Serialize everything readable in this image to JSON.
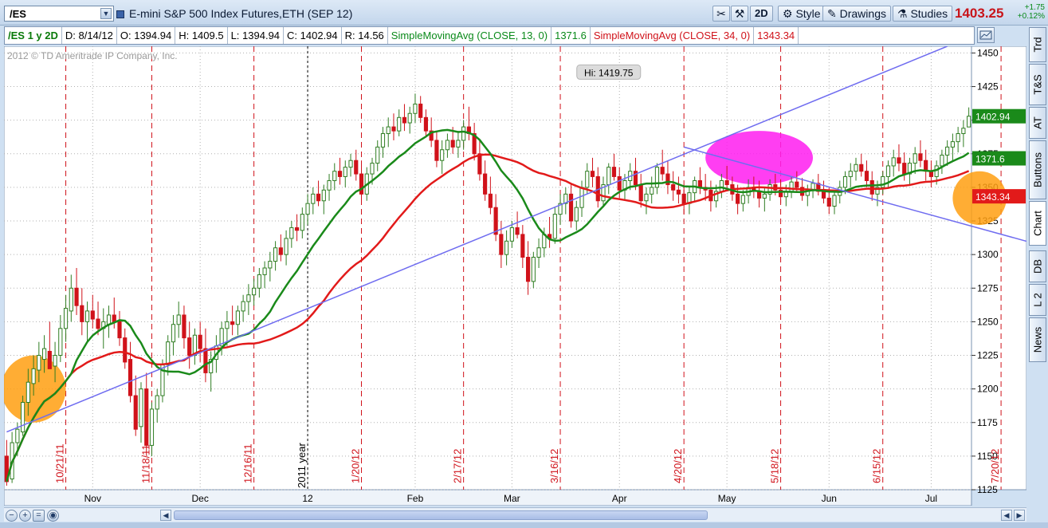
{
  "toolbar": {
    "symbol": "/ES",
    "title": "E-mini S&P 500 Index Futures,ETH (SEP 12)",
    "btn_2d": "2D",
    "btn_style": "Style",
    "btn_drawings": "Drawings",
    "btn_studies": "Studies",
    "last_price": "1403.25",
    "change_abs": "+1.75",
    "change_pct": "+0.12%"
  },
  "infobar": {
    "symbol_period": "/ES 1 y 2D",
    "date": "D: 8/14/12",
    "open": "O: 1394.94",
    "high": "H: 1409.5",
    "low": "L: 1394.94",
    "close": "C: 1402.94",
    "range": "R: 14.56",
    "sma13_label": "SimpleMovingAvg (CLOSE, 13, 0)",
    "sma13_value": "1371.6",
    "sma34_label": "SimpleMovingAvg (CLOSE, 34, 0)",
    "sma34_value": "1343.34"
  },
  "side_tabs": [
    "Trd",
    "T&S",
    "AT",
    "Buttons",
    "Chart",
    "DB",
    "L 2",
    "News"
  ],
  "colors": {
    "up_candle": "#2f7d22",
    "down_candle": "#d0121a",
    "sma13": "#1a8a1a",
    "sma34": "#e21a1a",
    "trendline": "#6f6cf0",
    "highlight_magenta": "#ff1cf0",
    "highlight_orange": "#ff9f10"
  },
  "chart_data": {
    "type": "candlestick",
    "watermark": "2012 © TD Ameritrade IP Company, Inc.",
    "ylim": [
      1125,
      1455
    ],
    "y_ticks": [
      1125,
      1150,
      1175,
      1200,
      1225,
      1250,
      1275,
      1300,
      1325,
      1350,
      1375,
      1400,
      1425,
      1450
    ],
    "x_month_labels": [
      {
        "label": "Nov",
        "bar": 16
      },
      {
        "label": "Dec",
        "bar": 36
      },
      {
        "label": "12",
        "bar": 56
      },
      {
        "label": "Feb",
        "bar": 76
      },
      {
        "label": "Mar",
        "bar": 94
      },
      {
        "label": "Apr",
        "bar": 114
      },
      {
        "label": "May",
        "bar": 134
      },
      {
        "label": "Jun",
        "bar": 153
      },
      {
        "label": "Jul",
        "bar": 172
      }
    ],
    "expiry_markers": [
      {
        "label": "10/21/11",
        "bar": 11
      },
      {
        "label": "11/18/11",
        "bar": 27
      },
      {
        "label": "12/16/11",
        "bar": 46
      },
      {
        "label": "1/20/12",
        "bar": 66
      },
      {
        "label": "2/17/12",
        "bar": 85
      },
      {
        "label": "3/16/12",
        "bar": 103
      },
      {
        "label": "4/20/12",
        "bar": 126
      },
      {
        "label": "5/18/12",
        "bar": 144
      },
      {
        "label": "6/15/12",
        "bar": 163
      },
      {
        "label": "7/20/12",
        "bar": 185
      }
    ],
    "year_marker": {
      "label": "2011 year",
      "bar": 56
    },
    "hi_annotation": {
      "label": "Hi: 1419.75",
      "bar": 112,
      "value": 1419.75
    },
    "price_labels": [
      {
        "value": 1402.94,
        "text": "1402.94",
        "kind": "last"
      },
      {
        "value": 1371.6,
        "text": "1371.6",
        "kind": "sma13"
      },
      {
        "value": 1343.34,
        "text": "1343.34",
        "kind": "sma34"
      }
    ],
    "ohlc": [
      [
        1150,
        1162,
        1128,
        1131
      ],
      [
        1133,
        1168,
        1130,
        1160
      ],
      [
        1160,
        1175,
        1150,
        1170
      ],
      [
        1168,
        1195,
        1165,
        1190
      ],
      [
        1190,
        1215,
        1180,
        1205
      ],
      [
        1204,
        1225,
        1195,
        1215
      ],
      [
        1214,
        1235,
        1205,
        1225
      ],
      [
        1222,
        1240,
        1212,
        1230
      ],
      [
        1228,
        1250,
        1220,
        1215
      ],
      [
        1217,
        1235,
        1205,
        1225
      ],
      [
        1225,
        1255,
        1220,
        1245
      ],
      [
        1245,
        1270,
        1235,
        1260
      ],
      [
        1258,
        1285,
        1250,
        1275
      ],
      [
        1275,
        1290,
        1255,
        1262
      ],
      [
        1262,
        1275,
        1240,
        1250
      ],
      [
        1250,
        1265,
        1235,
        1258
      ],
      [
        1258,
        1270,
        1245,
        1252
      ],
      [
        1252,
        1265,
        1240,
        1245
      ],
      [
        1245,
        1260,
        1230,
        1250
      ],
      [
        1248,
        1262,
        1238,
        1255
      ],
      [
        1255,
        1268,
        1245,
        1250
      ],
      [
        1250,
        1258,
        1232,
        1238
      ],
      [
        1238,
        1245,
        1215,
        1220
      ],
      [
        1222,
        1235,
        1190,
        1195
      ],
      [
        1195,
        1210,
        1165,
        1170
      ],
      [
        1172,
        1205,
        1160,
        1200
      ],
      [
        1200,
        1212,
        1150,
        1158
      ],
      [
        1158,
        1190,
        1150,
        1185
      ],
      [
        1185,
        1200,
        1175,
        1195
      ],
      [
        1195,
        1222,
        1190,
        1218
      ],
      [
        1218,
        1240,
        1210,
        1235
      ],
      [
        1235,
        1255,
        1225,
        1248
      ],
      [
        1248,
        1265,
        1238,
        1255
      ],
      [
        1255,
        1262,
        1230,
        1238
      ],
      [
        1238,
        1250,
        1215,
        1225
      ],
      [
        1225,
        1245,
        1218,
        1240
      ],
      [
        1240,
        1250,
        1220,
        1230
      ],
      [
        1230,
        1245,
        1205,
        1212
      ],
      [
        1212,
        1228,
        1198,
        1222
      ],
      [
        1222,
        1240,
        1212,
        1232
      ],
      [
        1232,
        1250,
        1225,
        1245
      ],
      [
        1245,
        1258,
        1232,
        1250
      ],
      [
        1250,
        1262,
        1240,
        1248
      ],
      [
        1248,
        1262,
        1240,
        1258
      ],
      [
        1258,
        1270,
        1250,
        1265
      ],
      [
        1265,
        1278,
        1255,
        1270
      ],
      [
        1270,
        1282,
        1262,
        1275
      ],
      [
        1275,
        1290,
        1268,
        1285
      ],
      [
        1285,
        1295,
        1275,
        1290
      ],
      [
        1290,
        1302,
        1280,
        1295
      ],
      [
        1295,
        1310,
        1288,
        1305
      ],
      [
        1305,
        1315,
        1295,
        1300
      ],
      [
        1300,
        1318,
        1292,
        1312
      ],
      [
        1312,
        1325,
        1305,
        1320
      ],
      [
        1320,
        1330,
        1310,
        1318
      ],
      [
        1318,
        1335,
        1312,
        1330
      ],
      [
        1330,
        1345,
        1322,
        1338
      ],
      [
        1338,
        1350,
        1330,
        1345
      ],
      [
        1345,
        1355,
        1336,
        1340
      ],
      [
        1340,
        1352,
        1330,
        1348
      ],
      [
        1348,
        1360,
        1340,
        1355
      ],
      [
        1355,
        1368,
        1348,
        1362
      ],
      [
        1362,
        1372,
        1352,
        1358
      ],
      [
        1358,
        1370,
        1350,
        1365
      ],
      [
        1365,
        1375,
        1358,
        1370
      ],
      [
        1370,
        1378,
        1355,
        1360
      ],
      [
        1360,
        1370,
        1340,
        1345
      ],
      [
        1345,
        1365,
        1340,
        1360
      ],
      [
        1360,
        1372,
        1352,
        1368
      ],
      [
        1368,
        1385,
        1362,
        1380
      ],
      [
        1380,
        1395,
        1372,
        1390
      ],
      [
        1390,
        1402,
        1380,
        1395
      ],
      [
        1395,
        1405,
        1385,
        1392
      ],
      [
        1392,
        1408,
        1388,
        1402
      ],
      [
        1402,
        1412,
        1392,
        1398
      ],
      [
        1398,
        1410,
        1390,
        1405
      ],
      [
        1405,
        1419.75,
        1398,
        1412
      ],
      [
        1412,
        1418,
        1398,
        1402
      ],
      [
        1402,
        1408,
        1388,
        1392
      ],
      [
        1392,
        1402,
        1380,
        1385
      ],
      [
        1385,
        1392,
        1365,
        1370
      ],
      [
        1370,
        1385,
        1360,
        1378
      ],
      [
        1378,
        1390,
        1372,
        1385
      ],
      [
        1385,
        1395,
        1375,
        1380
      ],
      [
        1380,
        1392,
        1372,
        1385
      ],
      [
        1385,
        1400,
        1378,
        1395
      ],
      [
        1395,
        1410,
        1385,
        1390
      ],
      [
        1390,
        1398,
        1370,
        1375
      ],
      [
        1375,
        1385,
        1355,
        1360
      ],
      [
        1360,
        1370,
        1340,
        1345
      ],
      [
        1345,
        1358,
        1330,
        1335
      ],
      [
        1335,
        1345,
        1310,
        1315
      ],
      [
        1315,
        1325,
        1290,
        1300
      ],
      [
        1300,
        1318,
        1292,
        1310
      ],
      [
        1310,
        1325,
        1305,
        1320
      ],
      [
        1320,
        1332,
        1312,
        1315
      ],
      [
        1315,
        1322,
        1290,
        1298
      ],
      [
        1298,
        1310,
        1270,
        1280
      ],
      [
        1280,
        1302,
        1275,
        1298
      ],
      [
        1298,
        1312,
        1290,
        1305
      ],
      [
        1305,
        1320,
        1298,
        1315
      ],
      [
        1315,
        1328,
        1305,
        1312
      ],
      [
        1312,
        1335,
        1308,
        1330
      ],
      [
        1330,
        1345,
        1322,
        1338
      ],
      [
        1338,
        1350,
        1330,
        1345
      ],
      [
        1345,
        1352,
        1320,
        1325
      ],
      [
        1325,
        1340,
        1318,
        1335
      ],
      [
        1335,
        1355,
        1328,
        1350
      ],
      [
        1350,
        1368,
        1345,
        1362
      ],
      [
        1362,
        1372,
        1350,
        1358
      ],
      [
        1358,
        1365,
        1335,
        1340
      ],
      [
        1340,
        1358,
        1335,
        1352
      ],
      [
        1352,
        1368,
        1345,
        1365
      ],
      [
        1365,
        1375,
        1355,
        1358
      ],
      [
        1358,
        1365,
        1342,
        1348
      ],
      [
        1348,
        1360,
        1340,
        1355
      ],
      [
        1355,
        1368,
        1348,
        1362
      ],
      [
        1362,
        1372,
        1348,
        1352
      ],
      [
        1352,
        1360,
        1335,
        1340
      ],
      [
        1340,
        1350,
        1330,
        1345
      ],
      [
        1345,
        1358,
        1338,
        1350
      ],
      [
        1350,
        1368,
        1345,
        1365
      ],
      [
        1365,
        1378,
        1355,
        1360
      ],
      [
        1360,
        1370,
        1345,
        1352
      ],
      [
        1352,
        1362,
        1340,
        1348
      ],
      [
        1348,
        1358,
        1338,
        1345
      ],
      [
        1345,
        1352,
        1330,
        1338
      ],
      [
        1338,
        1350,
        1330,
        1346
      ],
      [
        1346,
        1358,
        1340,
        1355
      ],
      [
        1355,
        1365,
        1345,
        1350
      ],
      [
        1350,
        1360,
        1340,
        1348
      ],
      [
        1348,
        1355,
        1332,
        1340
      ],
      [
        1340,
        1352,
        1335,
        1347
      ],
      [
        1347,
        1360,
        1342,
        1355
      ],
      [
        1355,
        1366,
        1348,
        1352
      ],
      [
        1352,
        1358,
        1340,
        1345
      ],
      [
        1345,
        1352,
        1330,
        1338
      ],
      [
        1338,
        1348,
        1332,
        1344
      ],
      [
        1344,
        1356,
        1338,
        1350
      ],
      [
        1350,
        1358,
        1342,
        1347
      ],
      [
        1347,
        1355,
        1335,
        1342
      ],
      [
        1342,
        1350,
        1332,
        1345
      ],
      [
        1345,
        1356,
        1340,
        1352
      ],
      [
        1352,
        1360,
        1344,
        1348
      ],
      [
        1348,
        1356,
        1338,
        1343
      ],
      [
        1343,
        1352,
        1336,
        1347
      ],
      [
        1347,
        1358,
        1342,
        1354
      ],
      [
        1354,
        1362,
        1346,
        1350
      ],
      [
        1350,
        1357,
        1340,
        1344
      ],
      [
        1344,
        1352,
        1336,
        1348
      ],
      [
        1348,
        1356,
        1342,
        1353
      ],
      [
        1353,
        1360,
        1344,
        1347
      ],
      [
        1347,
        1355,
        1338,
        1342
      ],
      [
        1342,
        1350,
        1330,
        1336
      ],
      [
        1336,
        1348,
        1330,
        1344
      ],
      [
        1344,
        1355,
        1338,
        1350
      ],
      [
        1350,
        1362,
        1345,
        1358
      ],
      [
        1358,
        1368,
        1350,
        1362
      ],
      [
        1362,
        1372,
        1355,
        1367
      ],
      [
        1367,
        1375,
        1358,
        1362
      ],
      [
        1362,
        1370,
        1350,
        1355
      ],
      [
        1355,
        1362,
        1340,
        1345
      ],
      [
        1345,
        1355,
        1336,
        1350
      ],
      [
        1350,
        1362,
        1345,
        1358
      ],
      [
        1358,
        1370,
        1350,
        1366
      ],
      [
        1366,
        1378,
        1358,
        1372
      ],
      [
        1372,
        1382,
        1362,
        1368
      ],
      [
        1368,
        1376,
        1355,
        1360
      ],
      [
        1360,
        1372,
        1352,
        1368
      ],
      [
        1368,
        1380,
        1360,
        1375
      ],
      [
        1375,
        1385,
        1365,
        1370
      ],
      [
        1370,
        1378,
        1355,
        1362
      ],
      [
        1362,
        1370,
        1350,
        1358
      ],
      [
        1358,
        1370,
        1352,
        1366
      ],
      [
        1366,
        1378,
        1360,
        1374
      ],
      [
        1374,
        1385,
        1366,
        1380
      ],
      [
        1380,
        1390,
        1370,
        1384
      ],
      [
        1384,
        1395,
        1376,
        1390
      ],
      [
        1390,
        1400,
        1380,
        1394
      ],
      [
        1394.94,
        1409.5,
        1394.94,
        1402.94
      ]
    ],
    "sma13": [],
    "sma34": [],
    "trendlines": [
      {
        "from": {
          "bar": 0,
          "value": 1168
        },
        "to": {
          "bar": 175,
          "value": 1455
        }
      },
      {
        "from": {
          "bar": 126,
          "value": 1380
        },
        "to": {
          "bar": 196,
          "value": 1303
        }
      }
    ],
    "highlights": [
      {
        "shape": "ellipse",
        "color": "orange",
        "center": {
          "bar": 5,
          "value": 1200
        },
        "span_bars": 6,
        "span_value": 25
      },
      {
        "shape": "ellipse",
        "color": "magenta",
        "center": {
          "bar": 140,
          "value": 1372
        },
        "span_bars": 10,
        "span_value": 20
      },
      {
        "shape": "ellipse",
        "color": "orange",
        "center": {
          "bar": 181,
          "value": 1342
        },
        "span_bars": 5,
        "span_value": 20
      }
    ]
  },
  "scroll_buttons": {
    "zoom_out": "−",
    "zoom_in": "+",
    "zoom_fit": "=",
    "zoom_reset": "◉"
  }
}
